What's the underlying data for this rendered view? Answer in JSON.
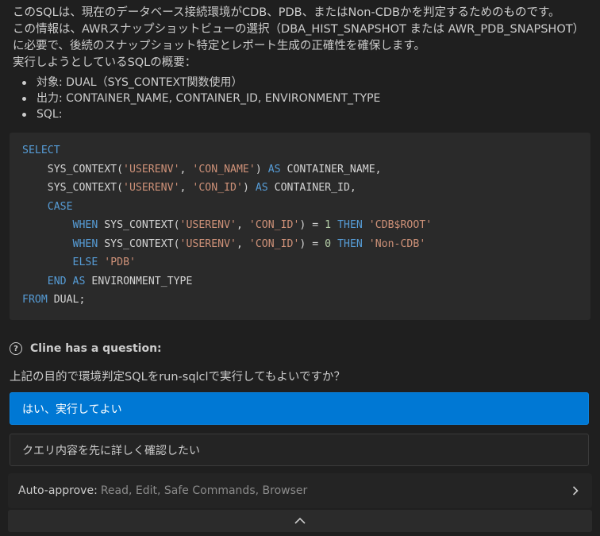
{
  "intro": {
    "line1": "このSQLは、現在のデータベース接続環境がCDB、PDB、またはNon-CDBかを判定するためのものです。",
    "line2": "この情報は、AWRスナップショットビューの選択（DBA_HIST_SNAPSHOT または AWR_PDB_SNAPSHOT）",
    "line3": "に必要で、後続のスナップショット特定とレポート生成の正確性を確保します。",
    "line4": "実行しようとしているSQLの概要："
  },
  "bullets": [
    {
      "text": "対象: DUAL（SYS_CONTEXT関数使用）"
    },
    {
      "text": "出力: CONTAINER_NAME, CONTAINER_ID, ENVIRONMENT_TYPE"
    },
    {
      "text": "SQL:"
    }
  ],
  "code": {
    "line1": {
      "kw": "SELECT"
    },
    "line2": {
      "indent": "    ",
      "fn": "SYS_CONTEXT(",
      "s1": "'USERENV'",
      "sep": ", ",
      "s2": "'CON_NAME'",
      "close": ") ",
      "as": "AS",
      "alias": " CONTAINER_NAME,"
    },
    "line3": {
      "indent": "    ",
      "fn": "SYS_CONTEXT(",
      "s1": "'USERENV'",
      "sep": ", ",
      "s2": "'CON_ID'",
      "close": ") ",
      "as": "AS",
      "alias": " CONTAINER_ID,"
    },
    "line4": {
      "indent": "    ",
      "kw": "CASE"
    },
    "line5": {
      "indent": "        ",
      "when": "WHEN",
      "fn": " SYS_CONTEXT(",
      "s1": "'USERENV'",
      "sep": ", ",
      "s2": "'CON_ID'",
      "op": ") = ",
      "num": "1",
      "sp": " ",
      "then": "THEN",
      "sp2": " ",
      "res": "'CDB$ROOT'"
    },
    "line6": {
      "indent": "        ",
      "when": "WHEN",
      "fn": " SYS_CONTEXT(",
      "s1": "'USERENV'",
      "sep": ", ",
      "s2": "'CON_ID'",
      "op": ") = ",
      "num": "0",
      "sp": " ",
      "then": "THEN",
      "sp2": " ",
      "res": "'Non-CDB'"
    },
    "line7": {
      "indent": "        ",
      "kw": "ELSE",
      "sp": " ",
      "res": "'PDB'"
    },
    "line8": {
      "indent": "    ",
      "end": "END",
      "sp": " ",
      "as": "AS",
      "alias": " ENVIRONMENT_TYPE"
    },
    "line9": {
      "kw": "FROM",
      "rest": " DUAL;"
    }
  },
  "question": {
    "icon": "question-circle-icon",
    "title": "Cline has a question:",
    "text": "上記の目的で環境判定SQLをrun-sqlclで実行してもよいですか？"
  },
  "options": {
    "primary": "はい、実行してよい",
    "secondary": "クエリ内容を先に詳しく確認したい"
  },
  "auto_approve": {
    "label": "Auto-approve:",
    "value": "Read, Edit, Safe Commands, Browser"
  },
  "colors": {
    "keyword": "#569cd6",
    "string": "#ce9178",
    "number": "#b5cea8",
    "primary_button": "#0078d4",
    "background": "#1f1f1f"
  }
}
